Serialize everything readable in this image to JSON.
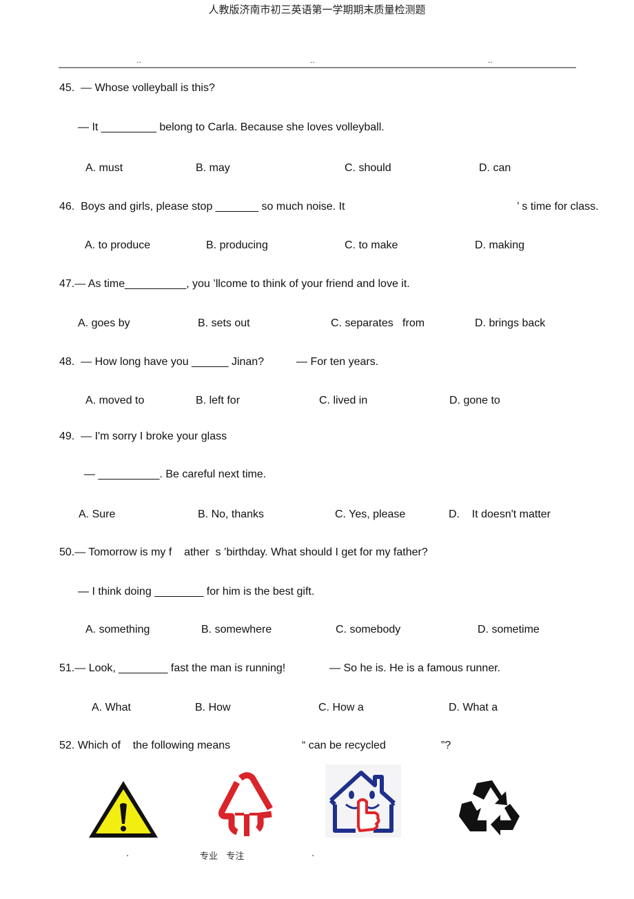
{
  "header": {
    "title": "人教版济南市初三英语第一学期期末质量检测题",
    "dots": [
      "..",
      "..",
      ".."
    ]
  },
  "questions": [
    {
      "number": "45.",
      "lines": [
        "45.  — Whose volleyball is this?",
        "— It _________ belong to Carla. Because she loves volleyball."
      ],
      "options": [
        "A. must",
        "B. may",
        "C. should",
        "D. can"
      ]
    },
    {
      "number": "46.",
      "lines": [
        "46.  Boys and girls, please stop _______ so much noise. It",
        "’ s time for class."
      ],
      "options": [
        "A. to produce",
        "B. producing",
        "C. to make",
        "D. making"
      ]
    },
    {
      "number": "47.",
      "lines": [
        "47.— As time__________, you ’llcome to think of your friend and love it."
      ],
      "options": [
        "A. goes by",
        "B. sets out",
        "C. separates   from",
        "D. brings back"
      ]
    },
    {
      "number": "48.",
      "lines": [
        "48.  — How long have you ______ Jinan?",
        "— For ten years."
      ],
      "options": [
        "A. moved to",
        "B. left for",
        "C. lived in",
        "D. gone to"
      ]
    },
    {
      "number": "49.",
      "lines": [
        "49.  — I'm sorry I broke your glass",
        "— __________. Be careful next time."
      ],
      "options": [
        "A. Sure",
        "B. No, thanks",
        "C. Yes, please",
        "D.    It doesn't matter"
      ]
    },
    {
      "number": "50.",
      "lines": [
        "50.— Tomorrow is my f    ather  s ’birthday. What should I get for my father?",
        "— I think doing ________ for him is the best gift."
      ],
      "options": [
        "A. something",
        "B. somewhere",
        "C. somebody",
        "D. sometime"
      ]
    },
    {
      "number": "51.",
      "lines": [
        "51.— Look, ________ fast the man is running!",
        "— So he is. He is a famous runner."
      ],
      "options": [
        "A. What",
        "B. How",
        "C. How a",
        "D. What a"
      ]
    },
    {
      "number": "52.",
      "lines": [
        "52. Which of    the following means",
        "“ can be recycled",
        "”?"
      ],
      "images": [
        "warning-sign",
        "tree-sign",
        "quiet-house-sign",
        "recycle-sign"
      ]
    }
  ],
  "footer": {
    "left_dot": ".",
    "text": "专业   专注",
    "right_dot": "."
  },
  "colors": {
    "warning_yellow": "#f3ee12",
    "tree_red": "#d8242a",
    "house_blue": "#1f2f8c",
    "finger_red": "#e0262a"
  }
}
